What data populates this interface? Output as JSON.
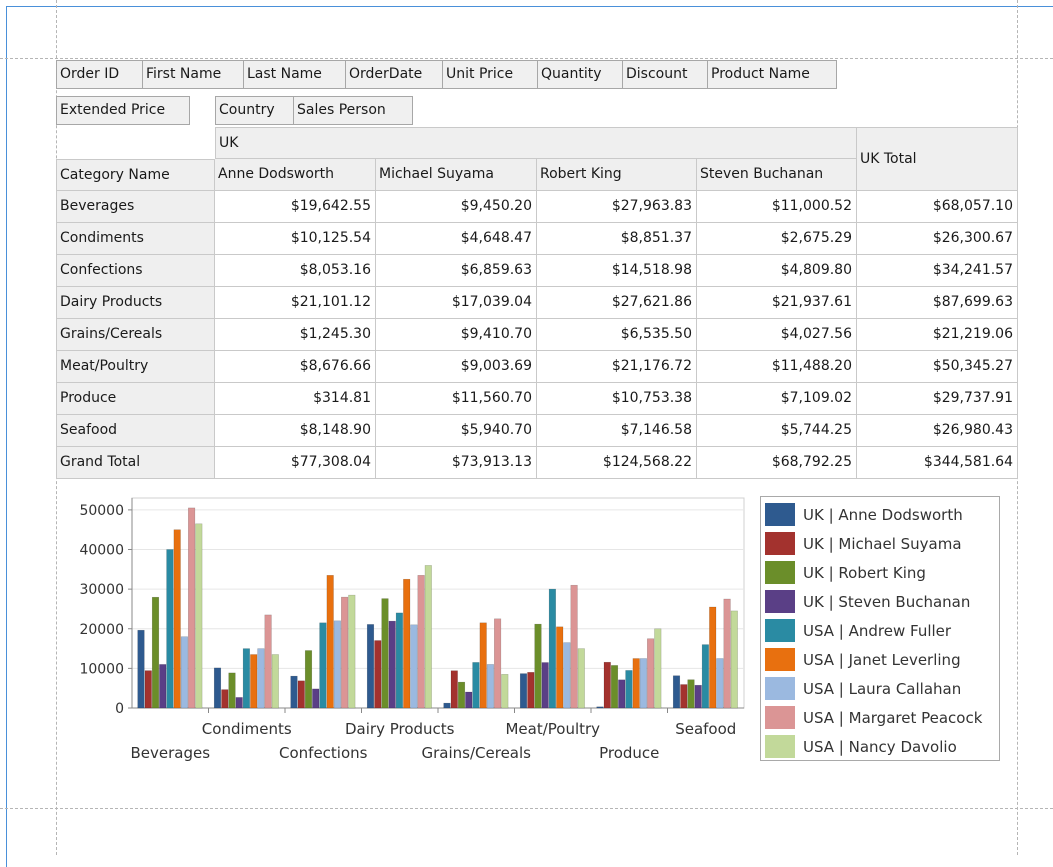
{
  "header_fields": [
    "Order ID",
    "First Name",
    "Last Name",
    "OrderDate",
    "Unit Price",
    "Quantity",
    "Discount",
    "Product Name"
  ],
  "data_field": "Extended Price",
  "column_fields": [
    "Country",
    "Sales Person"
  ],
  "column_group": "UK",
  "row_field": "Category Name",
  "columns": [
    "Anne Dodsworth",
    "Michael Suyama",
    "Robert King",
    "Steven Buchanan"
  ],
  "total_label": "UK Total",
  "rows": [
    {
      "label": "Beverages",
      "values": [
        "$19,642.55",
        "$9,450.20",
        "$27,963.83",
        "$11,000.52",
        "$68,057.10"
      ]
    },
    {
      "label": "Condiments",
      "values": [
        "$10,125.54",
        "$4,648.47",
        "$8,851.37",
        "$2,675.29",
        "$26,300.67"
      ]
    },
    {
      "label": "Confections",
      "values": [
        "$8,053.16",
        "$6,859.63",
        "$14,518.98",
        "$4,809.80",
        "$34,241.57"
      ]
    },
    {
      "label": "Dairy Products",
      "values": [
        "$21,101.12",
        "$17,039.04",
        "$27,621.86",
        "$21,937.61",
        "$87,699.63"
      ]
    },
    {
      "label": "Grains/Cereals",
      "values": [
        "$1,245.30",
        "$9,410.70",
        "$6,535.50",
        "$4,027.56",
        "$21,219.06"
      ]
    },
    {
      "label": "Meat/Poultry",
      "values": [
        "$8,676.66",
        "$9,003.69",
        "$21,176.72",
        "$11,488.20",
        "$50,345.27"
      ]
    },
    {
      "label": "Produce",
      "values": [
        "$314.81",
        "$11,560.70",
        "$10,753.38",
        "$7,109.02",
        "$29,737.91"
      ]
    },
    {
      "label": "Seafood",
      "values": [
        "$8,148.90",
        "$5,940.70",
        "$7,146.58",
        "$5,744.25",
        "$26,980.43"
      ]
    },
    {
      "label": "Grand Total",
      "values": [
        "$77,308.04",
        "$73,913.13",
        "$124,568.22",
        "$68,792.25",
        "$344,581.64"
      ]
    }
  ],
  "chart_data": {
    "type": "bar",
    "categories": [
      "Beverages",
      "Condiments",
      "Confections",
      "Dairy Products",
      "Grains/Cereals",
      "Meat/Poultry",
      "Produce",
      "Seafood"
    ],
    "ylim": [
      0,
      53000
    ],
    "yticks": [
      "0",
      "10000",
      "20000",
      "30000",
      "40000",
      "50000"
    ],
    "grid": true,
    "legend_position": "right",
    "series": [
      {
        "name": "UK | Anne Dodsworth",
        "color": "#2e5a8f",
        "values": [
          19642.55,
          10125.54,
          8053.16,
          21101.12,
          1245.3,
          8676.66,
          314.81,
          8148.9
        ]
      },
      {
        "name": "UK | Michael Suyama",
        "color": "#a3322e",
        "values": [
          9450.2,
          4648.47,
          6859.63,
          17039.04,
          9410.7,
          9003.69,
          11560.7,
          5940.7
        ]
      },
      {
        "name": "UK | Robert King",
        "color": "#6b8e2a",
        "values": [
          27963.83,
          8851.37,
          14518.98,
          27621.86,
          6535.5,
          21176.72,
          10753.38,
          7146.58
        ]
      },
      {
        "name": "UK | Steven Buchanan",
        "color": "#5a3f86",
        "values": [
          11000.52,
          2675.29,
          4809.8,
          21937.61,
          4027.56,
          11488.2,
          7109.02,
          5744.25
        ]
      },
      {
        "name": "USA | Andrew Fuller",
        "color": "#2a8ba3",
        "values": [
          40000,
          15000,
          21500,
          24000,
          11500,
          30000,
          9500,
          16000
        ]
      },
      {
        "name": "USA | Janet Leverling",
        "color": "#e8700f",
        "values": [
          45000,
          13500,
          33500,
          32500,
          21500,
          20500,
          12500,
          25500
        ]
      },
      {
        "name": "USA | Laura Callahan",
        "color": "#9bb9e0",
        "values": [
          18000,
          15000,
          22000,
          21000,
          11000,
          16500,
          12500,
          12500
        ]
      },
      {
        "name": "USA | Margaret Peacock",
        "color": "#db9595",
        "values": [
          50500,
          23500,
          28000,
          33500,
          22500,
          31000,
          17500,
          27500
        ]
      },
      {
        "name": "USA | Nancy Davolio",
        "color": "#c2d99a",
        "values": [
          46500,
          13500,
          28500,
          36000,
          8500,
          15000,
          20000,
          24500
        ]
      }
    ]
  }
}
